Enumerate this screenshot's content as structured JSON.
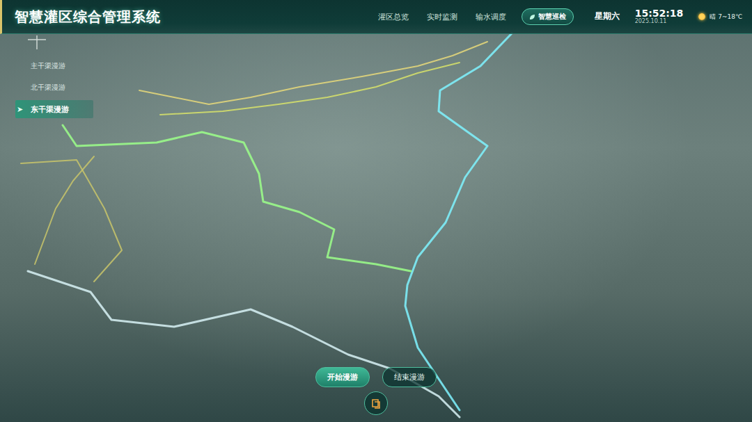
{
  "header": {
    "title": "智慧灌区综合管理系统"
  },
  "nav": [
    {
      "label": "灌区总览",
      "selected": false
    },
    {
      "label": "实时监测",
      "selected": false
    },
    {
      "label": "输水调度",
      "selected": false
    },
    {
      "label": "智慧巡检",
      "selected": true
    }
  ],
  "clock": {
    "weekday": "星期六",
    "time": "15:52:18",
    "date": "2025.10.11"
  },
  "weather": {
    "text": "晴 7~18℃"
  },
  "tour_menu": {
    "marker": "➤",
    "items": [
      {
        "label": "主干渠漫游",
        "selected": false
      },
      {
        "label": "北干渠漫游",
        "selected": false
      },
      {
        "label": "东干渠漫游",
        "selected": true
      }
    ]
  },
  "controls": {
    "buttons": [
      {
        "label": "开始漫游",
        "selected": true
      },
      {
        "label": "结束漫游",
        "selected": false
      }
    ]
  }
}
